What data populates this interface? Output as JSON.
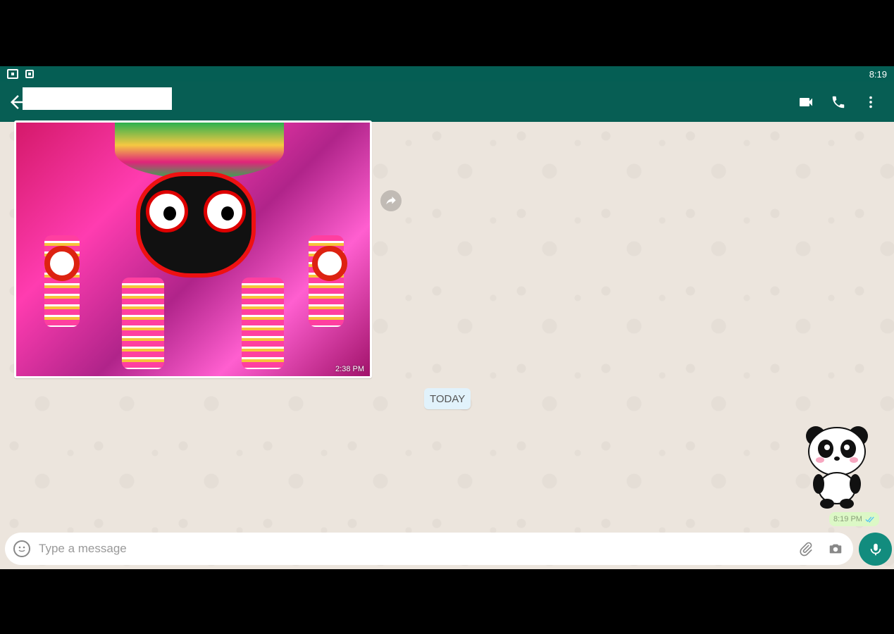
{
  "status_bar": {
    "time": "8:19",
    "icons": [
      "notification-icon",
      "notification-small-icon"
    ]
  },
  "header": {
    "contact_name": "",
    "actions": [
      "video-call-icon",
      "voice-call-icon",
      "more-options-icon"
    ]
  },
  "messages": {
    "image_message": {
      "time": "2:38 PM"
    },
    "date_divider": "TODAY",
    "sticker_message": {
      "time": "8:19 PM",
      "status": "read"
    }
  },
  "composer": {
    "placeholder": "Type a message",
    "value": ""
  },
  "colors": {
    "brand": "#075e54",
    "status_bar": "#055e54",
    "accent": "#128c7e",
    "chat_bg": "#ece5dd",
    "outgoing_bubble": "#dcf8c6",
    "date_chip": "#e1f2fb"
  }
}
